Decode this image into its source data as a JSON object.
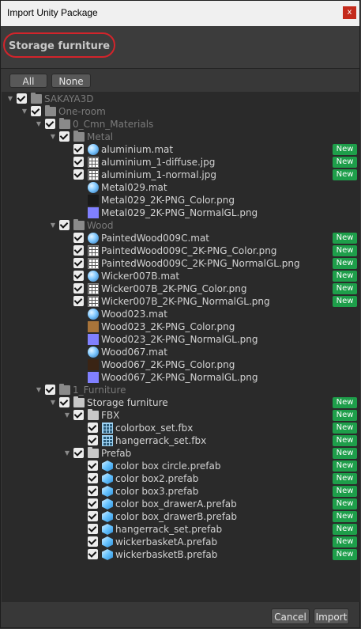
{
  "window": {
    "title": "Import Unity Package",
    "close_glyph": "x"
  },
  "package_name": "Storage furniture",
  "buttons": {
    "all": "All",
    "none": "None",
    "cancel": "Cancel",
    "import": "Import"
  },
  "badge_label": "New",
  "colors": {
    "new_badge": "#1e9e4a",
    "highlight_ring": "#d3242b"
  },
  "tree": [
    {
      "label": "SAKAYA3D",
      "depth": 0,
      "icon": "folder-icon",
      "expanded": true,
      "checked": true,
      "new": false,
      "dim": true
    },
    {
      "label": "One-room",
      "depth": 1,
      "icon": "folder-icon",
      "expanded": true,
      "checked": true,
      "new": false,
      "dim": true
    },
    {
      "label": "0_Cmn_Materials",
      "depth": 2,
      "icon": "folder-icon",
      "expanded": true,
      "checked": true,
      "new": false,
      "dim": true
    },
    {
      "label": "Metal",
      "depth": 3,
      "icon": "folder-icon",
      "expanded": true,
      "checked": true,
      "new": false,
      "dim": true
    },
    {
      "label": "aluminium.mat",
      "depth": 4,
      "icon": "material-icon",
      "checked": true,
      "new": true
    },
    {
      "label": "aluminium_1-diffuse.jpg",
      "depth": 4,
      "icon": "texture-icon",
      "checked": true,
      "new": true
    },
    {
      "label": "aluminium_1-normal.jpg",
      "depth": 4,
      "icon": "texture-icon",
      "checked": true,
      "new": true
    },
    {
      "label": "Metal029.mat",
      "depth": 4,
      "icon": "material-icon",
      "checked": false,
      "new": false
    },
    {
      "label": "Metal029_2K-PNG_Color.png",
      "depth": 4,
      "icon": "swatch-icon",
      "swatch": "#1a1a1a",
      "checked": false,
      "new": false
    },
    {
      "label": "Metal029_2K-PNG_NormalGL.png",
      "depth": 4,
      "icon": "swatch-icon",
      "swatch": "#8080ff",
      "checked": false,
      "new": false
    },
    {
      "label": "Wood",
      "depth": 3,
      "icon": "folder-icon",
      "expanded": true,
      "checked": true,
      "new": false,
      "dim": true
    },
    {
      "label": "PaintedWood009C.mat",
      "depth": 4,
      "icon": "material-icon",
      "checked": true,
      "new": true
    },
    {
      "label": "PaintedWood009C_2K-PNG_Color.png",
      "depth": 4,
      "icon": "texture-icon",
      "checked": true,
      "new": true
    },
    {
      "label": "PaintedWood009C_2K-PNG_NormalGL.png",
      "depth": 4,
      "icon": "texture-icon",
      "checked": true,
      "new": true
    },
    {
      "label": "Wicker007B.mat",
      "depth": 4,
      "icon": "material-icon",
      "checked": true,
      "new": true
    },
    {
      "label": "Wicker007B_2K-PNG_Color.png",
      "depth": 4,
      "icon": "texture-icon",
      "checked": true,
      "new": true
    },
    {
      "label": "Wicker007B_2K-PNG_NormalGL.png",
      "depth": 4,
      "icon": "texture-icon",
      "checked": true,
      "new": true
    },
    {
      "label": "Wood023.mat",
      "depth": 4,
      "icon": "material-icon",
      "checked": false,
      "new": false
    },
    {
      "label": "Wood023_2K-PNG_Color.png",
      "depth": 4,
      "icon": "swatch-icon",
      "swatch": "#a8743a",
      "checked": false,
      "new": false
    },
    {
      "label": "Wood023_2K-PNG_NormalGL.png",
      "depth": 4,
      "icon": "swatch-icon",
      "swatch": "#8080ff",
      "checked": false,
      "new": false
    },
    {
      "label": "Wood067.mat",
      "depth": 4,
      "icon": "material-icon",
      "checked": false,
      "new": false
    },
    {
      "label": "Wood067_2K-PNG_Color.png",
      "depth": 4,
      "icon": "swatch-icon",
      "swatch": "#3a2414",
      "checked": false,
      "new": false
    },
    {
      "label": "Wood067_2K-PNG_NormalGL.png",
      "depth": 4,
      "icon": "swatch-icon",
      "swatch": "#8080ff",
      "checked": false,
      "new": false
    },
    {
      "label": "1_Furniture",
      "depth": 2,
      "icon": "folder-icon",
      "expanded": true,
      "checked": true,
      "new": false,
      "dim": true
    },
    {
      "label": "Storage furniture",
      "depth": 3,
      "icon": "folder-icon",
      "expanded": true,
      "checked": true,
      "new": true,
      "dim": false
    },
    {
      "label": "FBX",
      "depth": 4,
      "icon": "folder-icon",
      "expanded": true,
      "checked": true,
      "new": true,
      "dim": false
    },
    {
      "label": "colorbox_set.fbx",
      "depth": 5,
      "icon": "fbx-icon",
      "checked": true,
      "new": true
    },
    {
      "label": "hangerrack_set.fbx",
      "depth": 5,
      "icon": "fbx-icon",
      "checked": true,
      "new": true
    },
    {
      "label": "Prefab",
      "depth": 4,
      "icon": "folder-icon",
      "expanded": true,
      "checked": true,
      "new": true,
      "dim": false
    },
    {
      "label": "color box circle.prefab",
      "depth": 5,
      "icon": "prefab-icon",
      "checked": true,
      "new": true
    },
    {
      "label": "color box2.prefab",
      "depth": 5,
      "icon": "prefab-icon",
      "checked": true,
      "new": true
    },
    {
      "label": "color box3.prefab",
      "depth": 5,
      "icon": "prefab-icon",
      "checked": true,
      "new": true
    },
    {
      "label": "color box_drawerA.prefab",
      "depth": 5,
      "icon": "prefab-icon",
      "checked": true,
      "new": true
    },
    {
      "label": "color box_drawerB.prefab",
      "depth": 5,
      "icon": "prefab-icon",
      "checked": true,
      "new": true
    },
    {
      "label": "hangerrack_set.prefab",
      "depth": 5,
      "icon": "prefab-icon",
      "checked": true,
      "new": true
    },
    {
      "label": "wickerbasketA.prefab",
      "depth": 5,
      "icon": "prefab-icon",
      "checked": true,
      "new": true
    },
    {
      "label": "wickerbasketB.prefab",
      "depth": 5,
      "icon": "prefab-icon",
      "checked": true,
      "new": true
    }
  ]
}
